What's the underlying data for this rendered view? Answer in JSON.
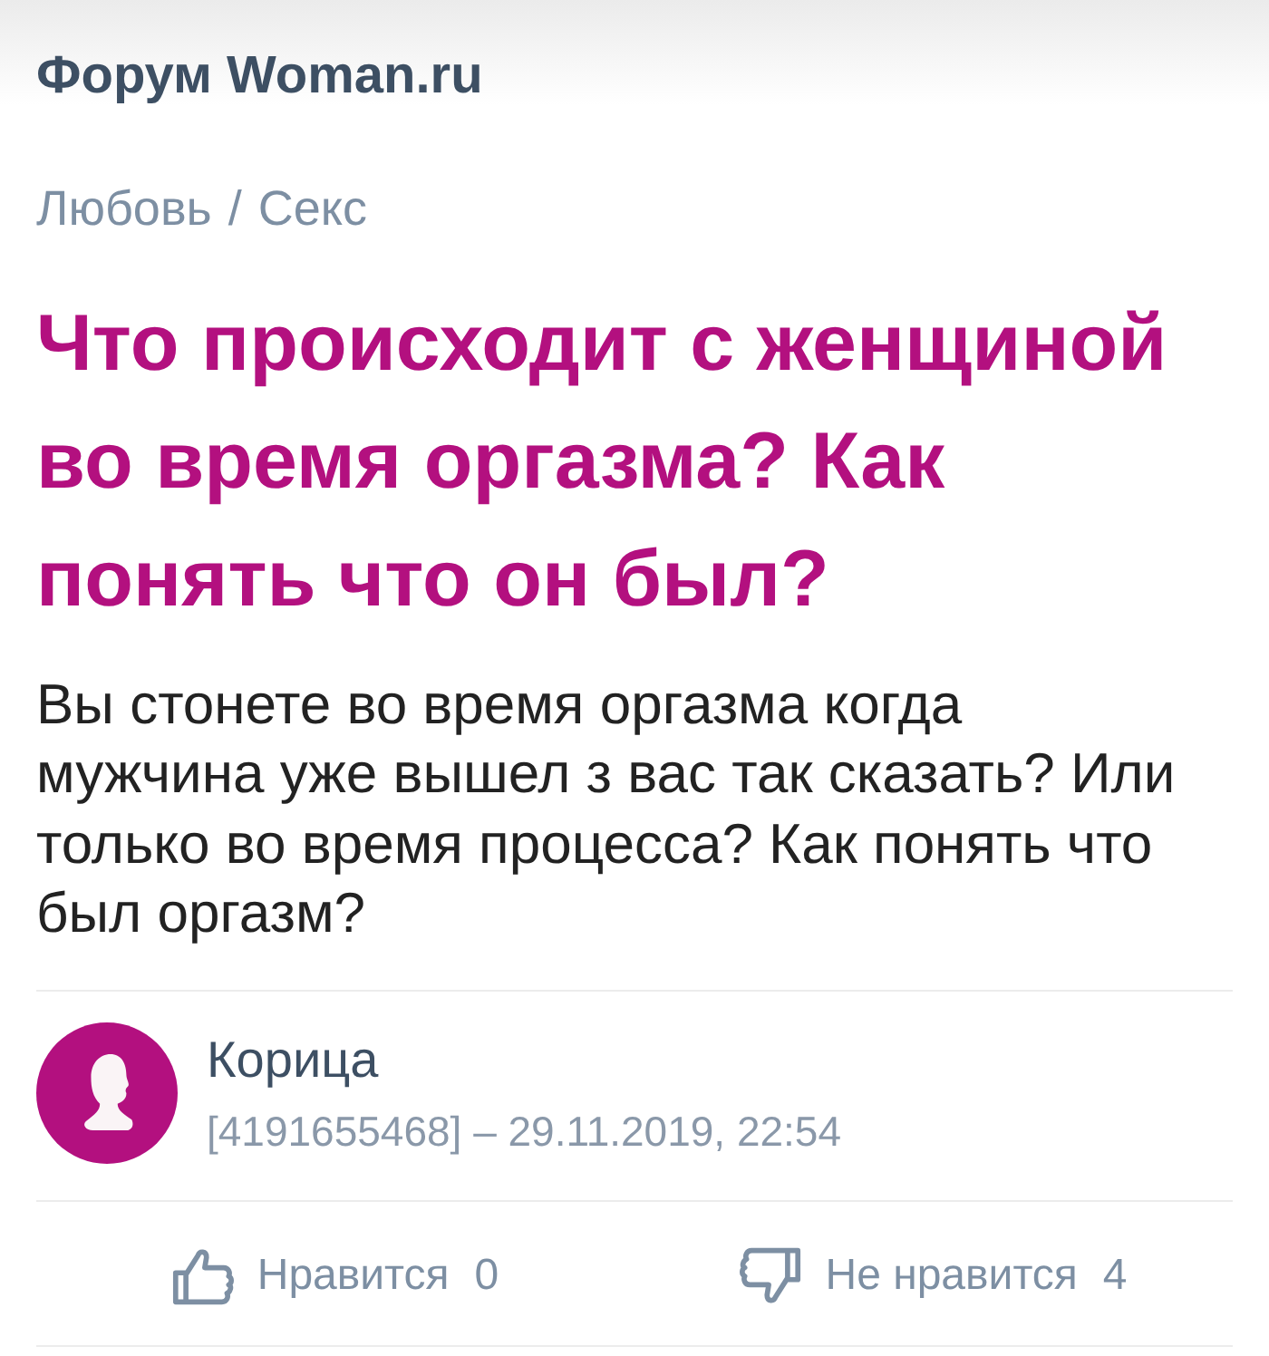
{
  "header": {
    "title": "Форум Woman.ru"
  },
  "breadcrumb": {
    "items": [
      "Любовь",
      "Секс"
    ],
    "separator": "/"
  },
  "question": {
    "title": "Что происходит с женщиной во время оргазма? Как понять что он был?",
    "body": "Вы стонете во время оргазма когда\nмужчина уже вышел з вас так сказать? Или только во время процесса? Как понять что был оргазм?"
  },
  "author": {
    "name": "Корица",
    "meta": "[4191655468] – 29.11.2019, 22:54"
  },
  "reactions": [
    {
      "kind": "like",
      "label": "Нравится",
      "count": "0"
    },
    {
      "kind": "dislike",
      "label": "Не нравится",
      "count": "4"
    }
  ]
}
